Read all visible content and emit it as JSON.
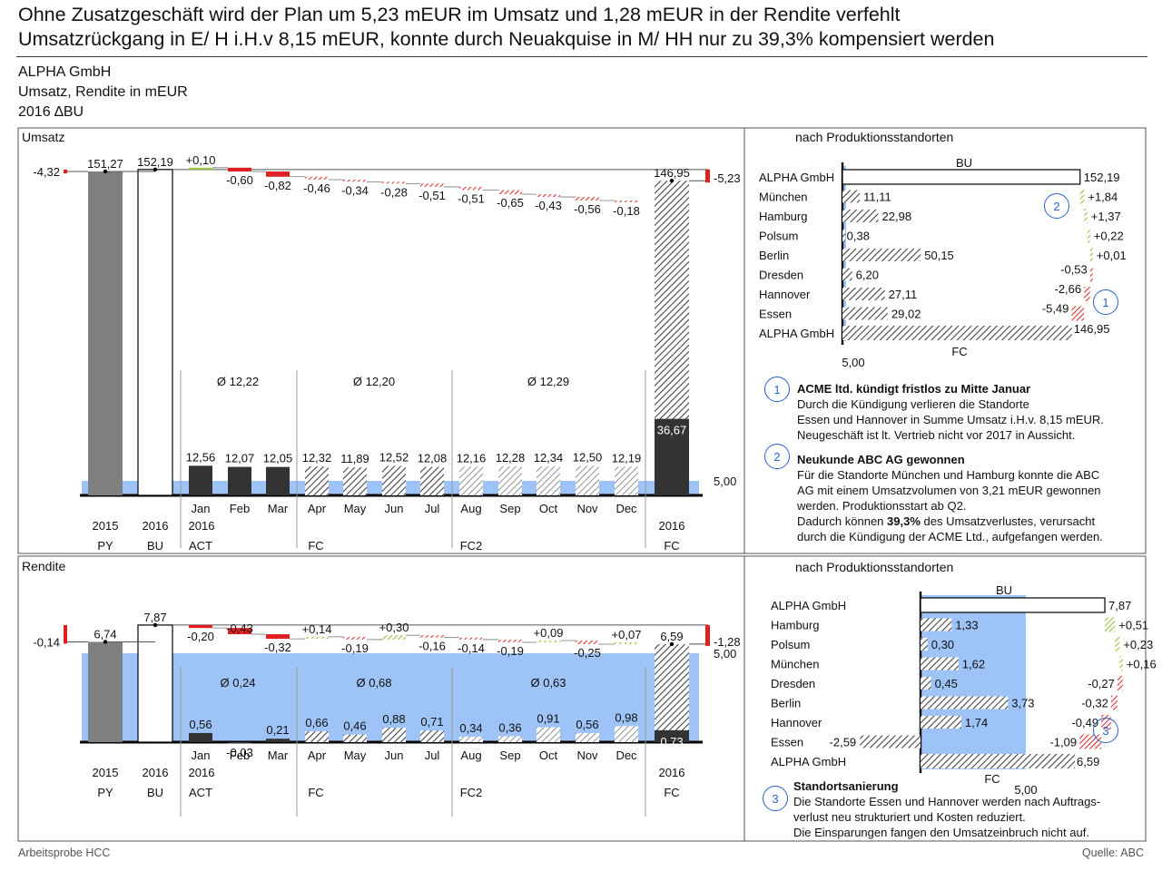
{
  "headline": {
    "line1": "Ohne Zusatzgeschäft wird der Plan um 5,23 mEUR im Umsatz und 1,28 mEUR in der Rendite verfehlt",
    "line2": "Umsatzrückgang in E/ H i.H.v 8,15 mEUR, konnte durch Neuakquise in M/ HH nur zu 39,3% kompensiert werden"
  },
  "subtitle": {
    "company": "ALPHA GmbH",
    "measure": "Umsatz, Rendite in mEUR",
    "scenario": "2016 ∆BU"
  },
  "footer": {
    "left": "Arbeitsprobe HCC",
    "right": "Quelle: ABC"
  },
  "colors": {
    "py": "#7f7f7f",
    "act": "#333333",
    "blue": "#9dc3f7",
    "neg": "#e02020",
    "pos": "#9ccc40",
    "hatch": "#444444"
  },
  "chart_data": [
    {
      "type": "bar",
      "title": "Umsatz",
      "categories": [
        "Jan",
        "Feb",
        "Mar",
        "Apr",
        "May",
        "Jun",
        "Jul",
        "Aug",
        "Sep",
        "Oct",
        "Nov",
        "Dec"
      ],
      "years": [
        "2015",
        "2016",
        "2016",
        "2016"
      ],
      "scenarios": [
        "PY",
        "BU",
        "ACT",
        "FC",
        "FC2",
        "FC"
      ],
      "totals": {
        "py": "151,27",
        "bu": "152,19",
        "fc": "146,95",
        "py_value": 151.27,
        "bu_value": 152.19,
        "fc_value": 146.95,
        "fc_act": "36,67",
        "fc_act_value": 36.67
      },
      "total_deltas": {
        "py": "-4,32",
        "fc": "-5,23"
      },
      "monthly_values": [
        12.56,
        12.07,
        12.05,
        12.32,
        11.89,
        12.52,
        12.08,
        12.16,
        12.28,
        12.34,
        12.5,
        12.19
      ],
      "monthly_labels": [
        "12,56",
        "12,07",
        "12,05",
        "12,32",
        "11,89",
        "12,52",
        "12,08",
        "12,16",
        "12,28",
        "12,34",
        "12,50",
        "12,19"
      ],
      "variances": [
        0.1,
        -0.6,
        -0.82,
        -0.46,
        -0.34,
        -0.28,
        -0.51,
        -0.51,
        -0.65,
        -0.43,
        -0.56,
        -0.18
      ],
      "variance_labels": [
        "+0,10",
        "-0,60",
        "-0,82",
        "-0,46",
        "-0,34",
        "-0,28",
        "-0,51",
        "-0,51",
        "-0,65",
        "-0,43",
        "-0,56",
        "-0,18"
      ],
      "averages": {
        "act": "Ø  12,22",
        "fc": "Ø  12,20",
        "fc2": "Ø  12,29"
      },
      "reference": {
        "value": 5.0,
        "label": "5,00"
      },
      "month_scenarios": [
        "ACT",
        "ACT",
        "ACT",
        "FC",
        "FC",
        "FC",
        "FC",
        "FC2",
        "FC2",
        "FC2",
        "FC2",
        "FC2"
      ]
    },
    {
      "type": "bar",
      "title": "nach Produktionsstandorten",
      "bu_label": "BU",
      "fc_label": "FC",
      "axis_label": "5,00",
      "rows": [
        {
          "name": "ALPHA GmbH",
          "value": 152.19,
          "label": "152,19",
          "kind": "bu"
        },
        {
          "name": "München",
          "value": 11.11,
          "label": "11,11",
          "delta": 1.84,
          "delta_label": "+1,84"
        },
        {
          "name": "Hamburg",
          "value": 22.98,
          "label": "22,98",
          "delta": 1.37,
          "delta_label": "+1,37"
        },
        {
          "name": "Polsum",
          "value": 0.38,
          "label": "0,38",
          "delta": 0.22,
          "delta_label": "+0,22"
        },
        {
          "name": "Berlin",
          "value": 50.15,
          "label": "50,15",
          "delta": 0.01,
          "delta_label": "+0,01"
        },
        {
          "name": "Dresden",
          "value": 6.2,
          "label": "6,20",
          "delta": -0.53,
          "delta_label": "-0,53"
        },
        {
          "name": "Hannover",
          "value": 27.11,
          "label": "27,11",
          "delta": -2.66,
          "delta_label": "-2,66"
        },
        {
          "name": "Essen",
          "value": 29.02,
          "label": "29,02",
          "delta": -5.49,
          "delta_label": "-5,49"
        },
        {
          "name": "ALPHA GmbH",
          "value": 146.95,
          "label": "146,95",
          "kind": "fc"
        }
      ]
    },
    {
      "type": "bar",
      "title": "Rendite",
      "categories": [
        "Jan",
        "Feb",
        "Mar",
        "Apr",
        "May",
        "Jun",
        "Jul",
        "Aug",
        "Sep",
        "Oct",
        "Nov",
        "Dec"
      ],
      "totals": {
        "py": "6,74",
        "bu": "7,87",
        "fc": "6,59",
        "py_value": 6.74,
        "bu_value": 7.87,
        "fc_value": 6.59,
        "fc_act": "0,73",
        "fc_act_value": 0.73
      },
      "total_deltas": {
        "py": "-0,14",
        "fc": "-1,28"
      },
      "monthly_values": [
        0.56,
        -0.03,
        0.21,
        0.66,
        0.46,
        0.88,
        0.71,
        0.34,
        0.36,
        0.91,
        0.56,
        0.98
      ],
      "monthly_labels": [
        "0,56",
        "-0,03",
        "0,21",
        "0,66",
        "0,46",
        "0,88",
        "0,71",
        "0,34",
        "0,36",
        "0,91",
        "0,56",
        "0,98"
      ],
      "variances": [
        -0.2,
        -0.43,
        -0.32,
        0.14,
        -0.19,
        0.3,
        -0.16,
        -0.14,
        -0.19,
        0.09,
        -0.25,
        0.07
      ],
      "variance_labels": [
        "-0,20",
        "-0,43",
        "-0,32",
        "+0,14",
        "-0,19",
        "+0,30",
        "-0,16",
        "-0,14",
        "-0,19",
        "+0,09",
        "-0,25",
        "+0,07"
      ],
      "averages": {
        "act": "Ø  0,24",
        "fc": "Ø  0,68",
        "fc2": "Ø  0,63"
      },
      "reference": {
        "value": 5.0,
        "label": "5,00"
      }
    },
    {
      "type": "bar",
      "title": "nach Produktionsstandorten",
      "bu_label": "BU",
      "fc_label": "FC",
      "axis_label": "5,00",
      "rows": [
        {
          "name": "ALPHA GmbH",
          "value": 7.87,
          "label": "7,87",
          "kind": "bu"
        },
        {
          "name": "Hamburg",
          "value": 1.33,
          "label": "1,33",
          "delta": 0.51,
          "delta_label": "+0,51"
        },
        {
          "name": "Polsum",
          "value": 0.3,
          "label": "0,30",
          "delta": 0.23,
          "delta_label": "+0,23"
        },
        {
          "name": "München",
          "value": 1.62,
          "label": "1,62",
          "delta": 0.16,
          "delta_label": "+0,16"
        },
        {
          "name": "Dresden",
          "value": 0.45,
          "label": "0,45",
          "delta": -0.27,
          "delta_label": "-0,27"
        },
        {
          "name": "Berlin",
          "value": 3.73,
          "label": "3,73",
          "delta": -0.32,
          "delta_label": "-0,32"
        },
        {
          "name": "Hannover",
          "value": 1.74,
          "label": "1,74",
          "delta": -0.49,
          "delta_label": "-0,49"
        },
        {
          "name": "Essen",
          "value": -2.59,
          "label": "-2,59",
          "delta": -1.09,
          "delta_label": "-1,09"
        },
        {
          "name": "ALPHA GmbH",
          "value": 6.59,
          "label": "6,59",
          "kind": "fc"
        }
      ]
    }
  ],
  "notes": {
    "n1": {
      "num": "1",
      "title": "ACME ltd. kündigt fristlos  zu Mitte Januar",
      "l1": "Durch die Kündigung verlieren die Standorte",
      "l2": "Essen und Hannover  in Summe Umsatz  i.H.v. 8,15 mEUR.",
      "l3": "Neugeschäft ist lt.  Vertrieb nicht vor 2017 in Aussicht."
    },
    "n2": {
      "num": "2",
      "title": "Neukunde ABC AG gewonnen",
      "l1": "Für die Standorte München und Hamburg konnte die ABC",
      "l2": "AG mit einem Umsatzvolumen  von 3,21 mEUR gewonnen",
      "l3": "werden.  Produktionsstart  ab Q2.",
      "l4a": "Dadurch können ",
      "l4b": "39,3%",
      "l4c": " des Umsatzverlustes,  verursacht",
      "l5": "durch die Kündigung der ACME Ltd., aufgefangen werden."
    },
    "n3": {
      "num": "3",
      "title": "Standortsanierung",
      "l1": "Die Standorte Essen und Hannover  werden nach Auftrags-",
      "l2": "verlust neu strukturiert und Kosten reduziert.",
      "l3": "Die Einsparungen fangen den Umsatzeinbruch  nicht auf."
    }
  }
}
